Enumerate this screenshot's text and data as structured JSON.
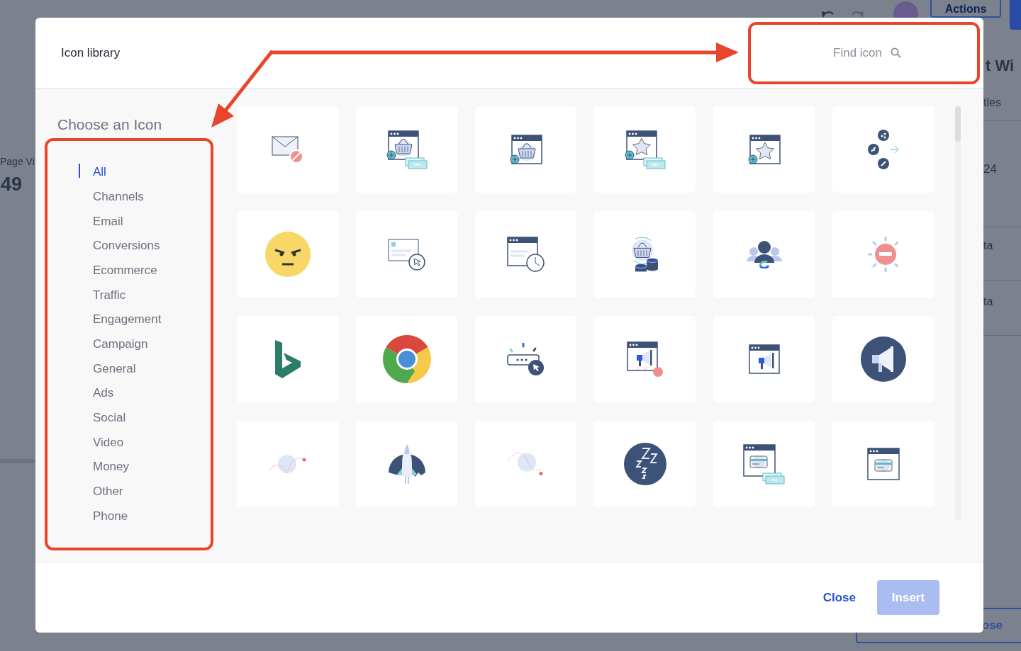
{
  "background_page": {
    "toolbar_button": "Actions",
    "left_label": "Page Vi",
    "left_value": "49",
    "heading_fragment": "t Wi",
    "right_texts": [
      "tles",
      "24",
      "ta",
      "ta"
    ],
    "bottom_button": "ose"
  },
  "modal": {
    "title": "Icon library",
    "search": {
      "placeholder": "Find icon"
    },
    "sidebar": {
      "heading": "Choose an Icon",
      "categories": [
        {
          "label": "All",
          "selected": true
        },
        {
          "label": "Channels",
          "selected": false
        },
        {
          "label": "Email",
          "selected": false
        },
        {
          "label": "Conversions",
          "selected": false
        },
        {
          "label": "Ecommerce",
          "selected": false
        },
        {
          "label": "Traffic",
          "selected": false
        },
        {
          "label": "Engagement",
          "selected": false
        },
        {
          "label": "Campaign",
          "selected": false
        },
        {
          "label": "General",
          "selected": false
        },
        {
          "label": "Ads",
          "selected": false
        },
        {
          "label": "Social",
          "selected": false
        },
        {
          "label": "Video",
          "selected": false
        },
        {
          "label": "Money",
          "selected": false
        },
        {
          "label": "Other",
          "selected": false
        },
        {
          "label": "Phone",
          "selected": false
        }
      ]
    },
    "icons": [
      {
        "kind": "mailblock"
      },
      {
        "kind": "basketcash"
      },
      {
        "kind": "basket"
      },
      {
        "kind": "starcash"
      },
      {
        "kind": "star"
      },
      {
        "kind": "share"
      },
      {
        "kind": "angry"
      },
      {
        "kind": "click"
      },
      {
        "kind": "clock"
      },
      {
        "kind": "coins"
      },
      {
        "kind": "team"
      },
      {
        "kind": "stop"
      },
      {
        "kind": "bing"
      },
      {
        "kind": "chrome"
      },
      {
        "kind": "password"
      },
      {
        "kind": "megadot"
      },
      {
        "kind": "mega"
      },
      {
        "kind": "megaphone"
      },
      {
        "kind": "bounce"
      },
      {
        "kind": "rocket"
      },
      {
        "kind": "bouncedown"
      },
      {
        "kind": "sleep"
      },
      {
        "kind": "cardcash"
      },
      {
        "kind": "card"
      }
    ],
    "buttons": [
      {
        "label": "Close",
        "kind": "link"
      },
      {
        "label": "Insert",
        "kind": "primary",
        "disabled": true
      }
    ]
  }
}
